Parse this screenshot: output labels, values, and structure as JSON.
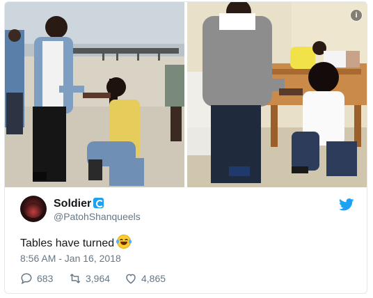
{
  "tweet": {
    "display_name": "Soldier",
    "handle": "@PatohShanqueels",
    "text": "Tables have turned",
    "timestamp": "8:56 AM - Jan 16, 2018",
    "replies": "683",
    "retweets": "3,964",
    "likes": "4,865"
  },
  "icons": {
    "info": "info-icon",
    "verified": "verified-icon",
    "bird": "twitter-bird-icon",
    "emoji": "face-with-tears-of-joy-icon",
    "reply": "reply-icon",
    "retweet": "retweet-icon",
    "like": "heart-icon"
  },
  "colors": {
    "brand": "#1da1f2",
    "text": "#14171a",
    "muted": "#657786"
  }
}
